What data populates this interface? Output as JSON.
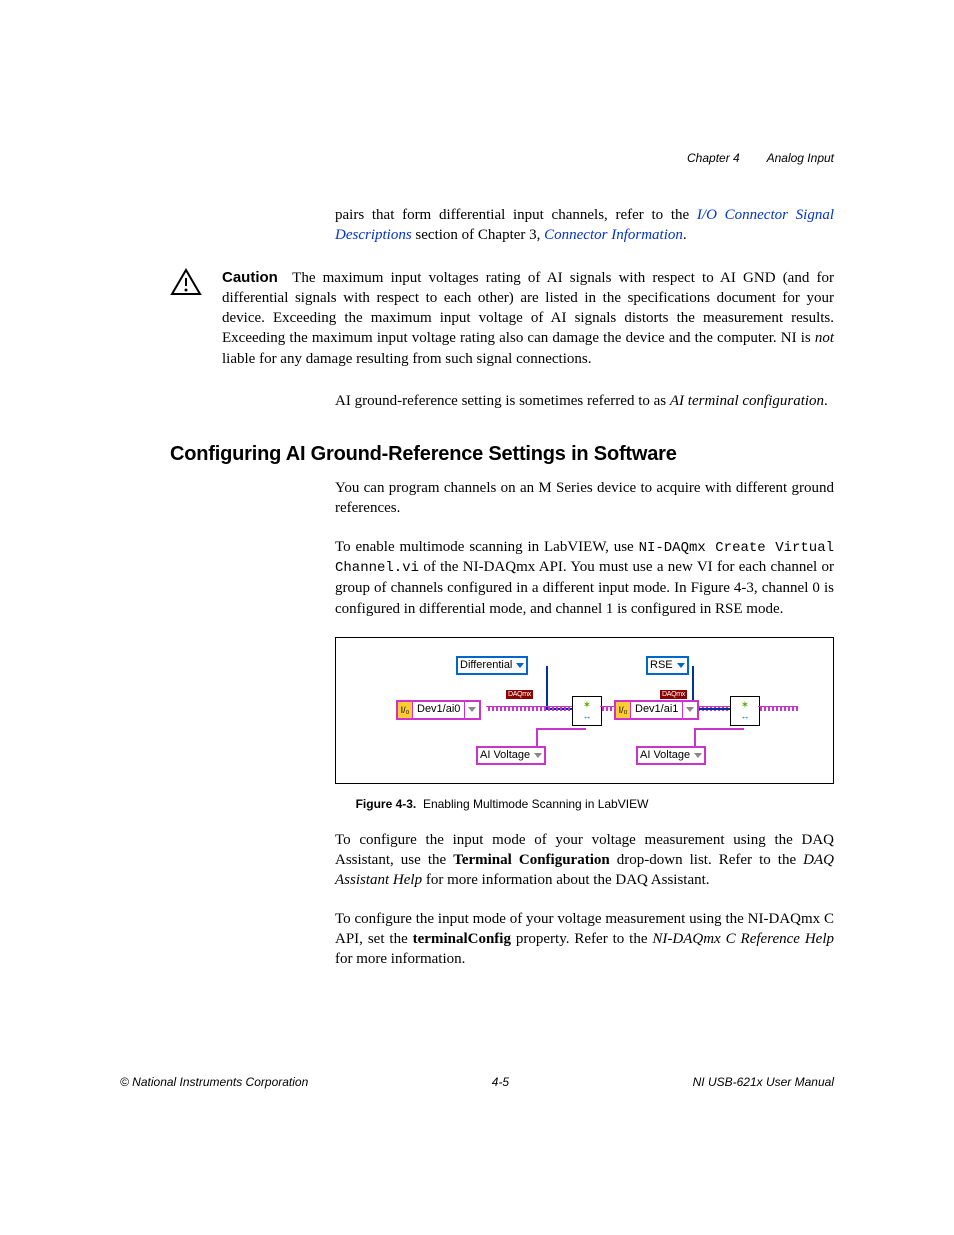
{
  "header": {
    "chapter": "Chapter 4",
    "title": "Analog Input"
  },
  "intro": {
    "pre": "pairs that form differential input channels, refer to the ",
    "link1": "I/O Connector Signal Descriptions",
    "mid": " section of Chapter 3, ",
    "link2": "Connector Information",
    "post": "."
  },
  "caution": {
    "label": "Caution",
    "text_pre": "The maximum input voltages rating of AI signals with respect to AI GND (and for differential signals with respect to each other) are listed in the specifications document for your device. Exceeding the maximum input voltage of AI signals distorts the measurement results. Exceeding the maximum input voltage rating also can damage the device and the computer. NI is ",
    "not": "not",
    "text_post": " liable for any damage resulting from such signal connections."
  },
  "after_caution": {
    "pre": "AI ground-reference setting is sometimes referred to as ",
    "italic": "AI terminal configuration",
    "post": "."
  },
  "heading": "Configuring AI Ground-Reference Settings in Software",
  "para1": "You can program channels on an M Series device to acquire with different ground references.",
  "para2": {
    "pre": "To enable multimode scanning in LabVIEW, use ",
    "code": "NI-DAQmx Create Virtual Channel.vi",
    "post": " of the NI-DAQmx API. You must use a new VI for each channel or group of channels configured in a different input mode. In Figure 4-3, channel 0 is configured in differential mode, and channel 1 is configured in RSE mode."
  },
  "figure": {
    "diff": "Differential",
    "rse": "RSE",
    "dev0": "Dev1/ai0",
    "dev1": "Dev1/ai1",
    "aivolt": "AI Voltage",
    "daqmx": "DAQmx"
  },
  "fig_caption": {
    "bold": "Figure 4-3.",
    "text": "Enabling Multimode Scanning in LabVIEW"
  },
  "para3": {
    "pre": "To configure the input mode of your voltage measurement using the DAQ Assistant, use the ",
    "bold": "Terminal Configuration",
    "mid": " drop-down list. Refer to the ",
    "italic": "DAQ Assistant Help",
    "post": " for more information about the DAQ Assistant."
  },
  "para4": {
    "pre": "To configure the input mode of your voltage measurement using the NI-DAQmx C API, set the ",
    "bold": "terminalConfig",
    "mid": " property. Refer to the ",
    "italic": "NI-DAQmx C Reference Help",
    "post": " for more information."
  },
  "footer": {
    "left": "© National Instruments Corporation",
    "center": "4-5",
    "right": "NI USB-621x User Manual"
  }
}
